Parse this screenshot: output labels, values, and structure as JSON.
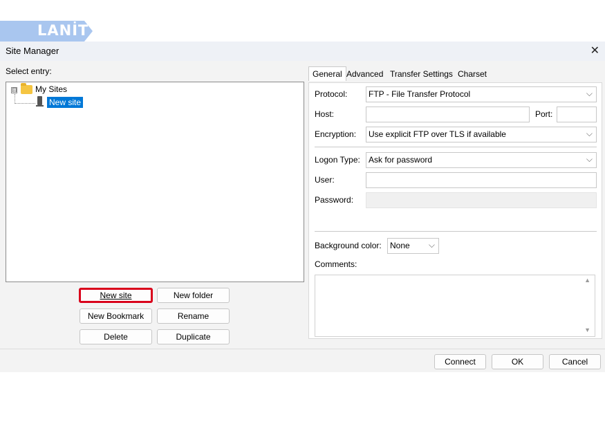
{
  "logo": {
    "text": "LANİT"
  },
  "window": {
    "title": "Site Manager",
    "close_icon": "close-icon"
  },
  "left": {
    "select_label": "Select entry:",
    "tree": {
      "root_label": "My Sites",
      "expander": "⊟",
      "items": [
        {
          "label": "New site",
          "selected": true
        }
      ]
    },
    "buttons": {
      "new_site": "New site",
      "new_folder": "New folder",
      "new_bookmark": "New Bookmark",
      "rename": "Rename",
      "delete": "Delete",
      "duplicate": "Duplicate"
    },
    "highlight_color": "#d9001b"
  },
  "tabs": [
    {
      "label": "General",
      "active": true
    },
    {
      "label": "Advanced",
      "active": false
    },
    {
      "label": "Transfer Settings",
      "active": false
    },
    {
      "label": "Charset",
      "active": false
    }
  ],
  "general": {
    "protocol_label": "Protocol:",
    "protocol_value": "FTP - File Transfer Protocol",
    "host_label": "Host:",
    "host_value": "",
    "port_label": "Port:",
    "port_value": "",
    "encryption_label": "Encryption:",
    "encryption_value": "Use explicit FTP over TLS if available",
    "logon_type_label": "Logon Type:",
    "logon_type_value": "Ask for password",
    "user_label": "User:",
    "user_value": "",
    "password_label": "Password:",
    "bg_color_label": "Background color:",
    "bg_color_value": "None",
    "comments_label": "Comments:",
    "comments_value": ""
  },
  "footer": {
    "connect": "Connect",
    "ok": "OK",
    "cancel": "Cancel"
  },
  "colors": {
    "selection": "#0078d7",
    "logo": "#a9c6ef",
    "window_bg": "#f3f3f3"
  }
}
